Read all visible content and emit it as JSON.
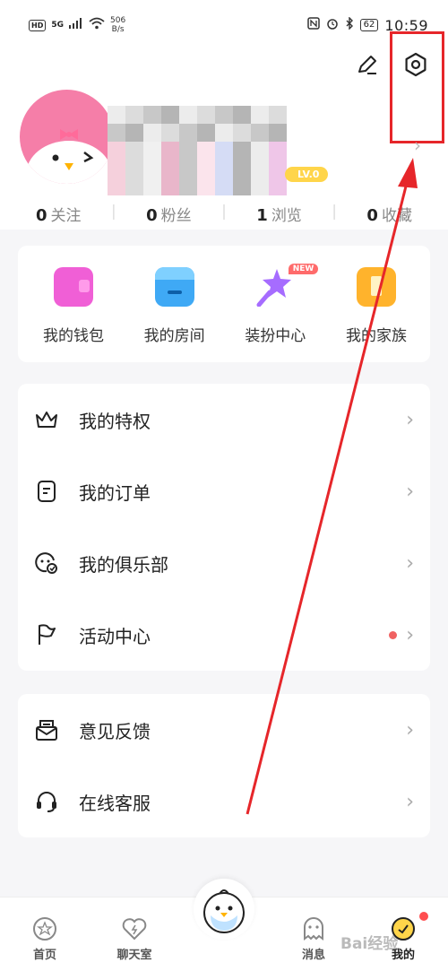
{
  "status_bar": {
    "hd_label": "HD",
    "network_label": "5G",
    "net_speed_value": "506",
    "net_speed_unit": "B/s",
    "battery": "62",
    "time": "10:59"
  },
  "profile": {
    "level_badge": "LV.0",
    "stats": [
      {
        "value": "0",
        "label": "关注"
      },
      {
        "value": "0",
        "label": "粉丝"
      },
      {
        "value": "1",
        "label": "浏览"
      },
      {
        "value": "0",
        "label": "收藏"
      }
    ]
  },
  "quick_actions": [
    {
      "label": "我的钱包",
      "icon": "wallet-icon",
      "color": "#f05fd6"
    },
    {
      "label": "我的房间",
      "icon": "shop-icon",
      "color": "#3fa9f5"
    },
    {
      "label": "装扮中心",
      "icon": "magic-wand-icon",
      "color": "#a66cff",
      "badge": "NEW"
    },
    {
      "label": "我的家族",
      "icon": "family-icon",
      "color": "#ffb32c"
    }
  ],
  "menu_group_1": [
    {
      "label": "我的特权",
      "icon": "crown-icon"
    },
    {
      "label": "我的订单",
      "icon": "order-icon"
    },
    {
      "label": "我的俱乐部",
      "icon": "club-icon"
    },
    {
      "label": "活动中心",
      "icon": "flag-icon",
      "dot": true
    }
  ],
  "menu_group_2": [
    {
      "label": "意见反馈",
      "icon": "feedback-icon"
    },
    {
      "label": "在线客服",
      "icon": "headset-icon"
    }
  ],
  "tabbar": {
    "tabs": [
      {
        "label": "首页",
        "icon": "home-icon"
      },
      {
        "label": "聊天室",
        "icon": "chat-room-icon"
      },
      {
        "label": "消息",
        "icon": "message-icon"
      },
      {
        "label": "我的",
        "icon": "me-icon"
      }
    ]
  },
  "watermark": "Bai经验",
  "colors": {
    "highlight": "#e6262a",
    "accent_pink": "#f57ea8",
    "badge_yellow": "#ffd54a"
  }
}
